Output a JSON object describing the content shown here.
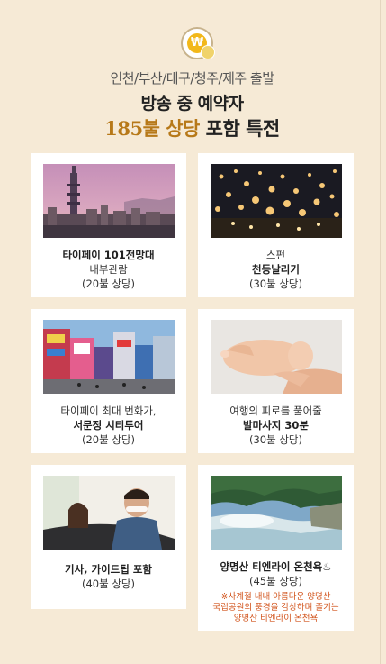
{
  "header": {
    "badge_symbol": "₩",
    "subtitle": "인천/부산/대구/청주/제주 출발",
    "title": "방송 중 예약자",
    "highlight": "185불 상당",
    "title_rest": " 포함 특전"
  },
  "colors": {
    "background": "#f6ead6",
    "highlight": "#b77919",
    "note": "#d2541c"
  },
  "cards": [
    {
      "image": "taipei-101-skyline",
      "lines": [
        "타이페이 101전망대",
        "내부관람",
        "(20불 상당)"
      ]
    },
    {
      "image": "sky-lanterns-night",
      "lines": [
        "스펀",
        "천등날리기",
        "(30불 상당)"
      ]
    },
    {
      "image": "ximending-street",
      "lines": [
        "타이페이 최대 번화가,",
        "서문정 시티투어",
        "(20불 상당)"
      ]
    },
    {
      "image": "foot-massage",
      "lines": [
        "여행의 피로를 풀어줄",
        "발마사지 30분",
        "(30불 상당)"
      ]
    },
    {
      "image": "driver-in-car",
      "lines": [
        "기사, 가이드팁 포함",
        "(40불 상당)"
      ]
    },
    {
      "image": "hot-spring-river",
      "lines": [
        "양명산 티엔라이 온천욕♨",
        "(45불 상당)"
      ],
      "note": [
        "※사계절 내내 아름다운 양명산",
        "국립공원의 풍경을 감상하며 즐기는",
        "양명산 티엔라이 온천욕"
      ]
    }
  ]
}
